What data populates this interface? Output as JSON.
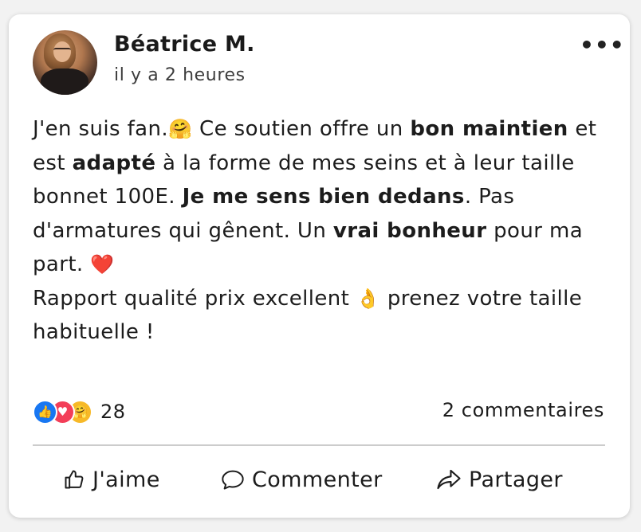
{
  "post": {
    "author": "Béatrice M.",
    "time": "il y a 2 heures",
    "more": "•••",
    "body": {
      "t1": "J'en suis fan.",
      "e1": "🤗",
      "t2": " Ce soutien offre un ",
      "b1": "bon maintien",
      "t3": " et est ",
      "b2": "adapté",
      "t4": " à la forme de mes seins et à leur taille bonnet 100E. ",
      "b3": "Je me sens bien dedans",
      "t5": ". Pas d'armatures qui gênent. Un ",
      "b4": "vrai bonheur",
      "t6": " pour ma part. ",
      "e2": "❤️",
      "t7": "Rapport qualité prix excellent ",
      "e3": "👌",
      "t8": " prenez votre taille habituelle !"
    }
  },
  "reactions": {
    "icons": [
      "like-icon",
      "love-icon",
      "care-icon"
    ],
    "like_glyph": "👍",
    "love_glyph": "♥",
    "care_glyph": "🤗",
    "count": "28"
  },
  "comments_count": "2 commentaires",
  "actions": {
    "like": "J'aime",
    "comment": "Commenter",
    "share": "Partager"
  },
  "colors": {
    "like": "#1877f2",
    "love": "#f33e58",
    "care": "#f7b928"
  }
}
